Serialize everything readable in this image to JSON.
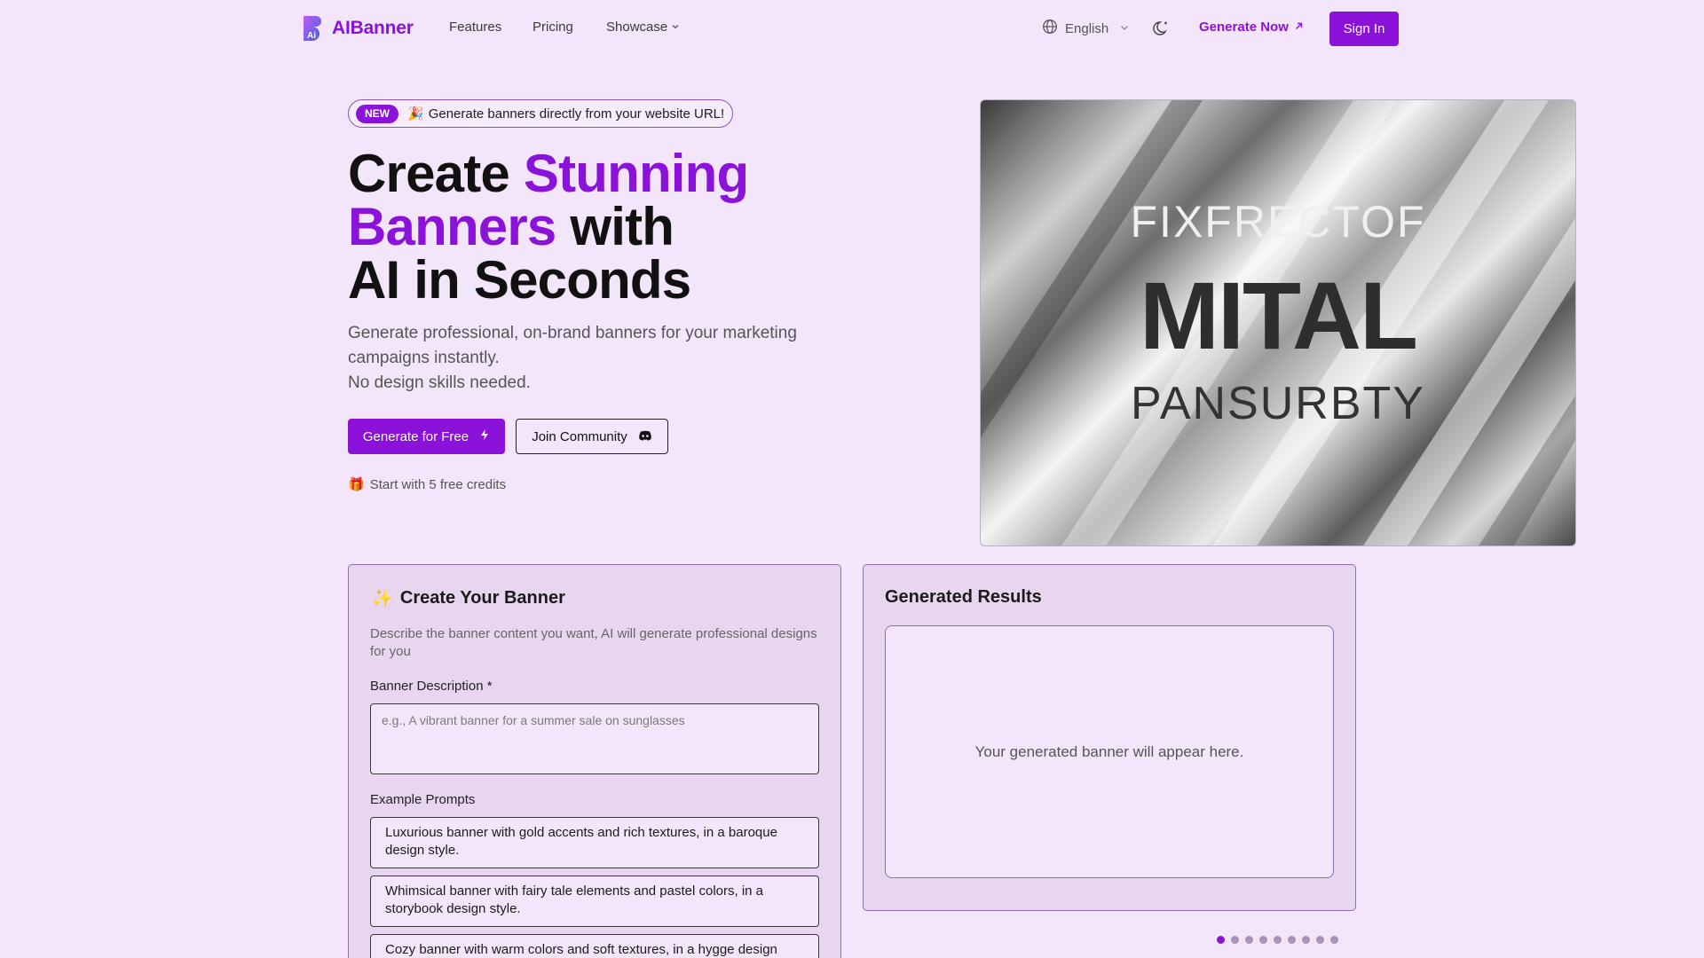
{
  "nav": {
    "brand": "AIBanner",
    "links": [
      "Features",
      "Pricing",
      "Showcase"
    ],
    "language": "English",
    "generate_now": "Generate Now",
    "sign_in": "Sign In"
  },
  "hero": {
    "badge_pill": "NEW",
    "badge_text": "Generate banners directly from your website URL!",
    "title_part1": "Create ",
    "title_accent1": "Stunning",
    "title_accent2": "Banners",
    "title_part2": " with",
    "title_line3": "AI in Seconds",
    "subtitle_line1": "Generate professional, on-brand banners for your marketing",
    "subtitle_line2": "campaigns instantly.",
    "subtitle_line3": "No design skills needed.",
    "primary_button": "Generate for Free",
    "secondary_button": "Join Community",
    "credits_note": "Start with 5 free credits"
  },
  "hero_image": {
    "line1": "FIXFRECTOF",
    "line2": "MITAL",
    "line3": "PANSURBTY"
  },
  "create_card": {
    "title": "Create Your Banner",
    "description": "Describe the banner content you want, AI will generate professional designs for you",
    "description_label": "Banner Description *",
    "description_placeholder": "e.g., A vibrant banner for a summer sale on sunglasses",
    "examples_label": "Example Prompts",
    "examples": [
      "Luxurious banner with gold accents and rich textures, in a baroque design style.",
      "Whimsical banner with fairy tale elements and pastel colors, in a storybook design style.",
      "Cozy banner with warm colors and soft textures, in a hygge design style."
    ]
  },
  "results_card": {
    "title": "Generated Results",
    "placeholder": "Your generated banner will appear here."
  },
  "carousel": {
    "total": 9,
    "active_index": 0
  },
  "colors": {
    "accent": "#8a12d9",
    "background": "#f3e6fb",
    "card": "#e8d6f1"
  },
  "icons": {
    "badge_emoji": "🎉",
    "credits_emoji": "🎁",
    "create_emoji": "✨"
  }
}
